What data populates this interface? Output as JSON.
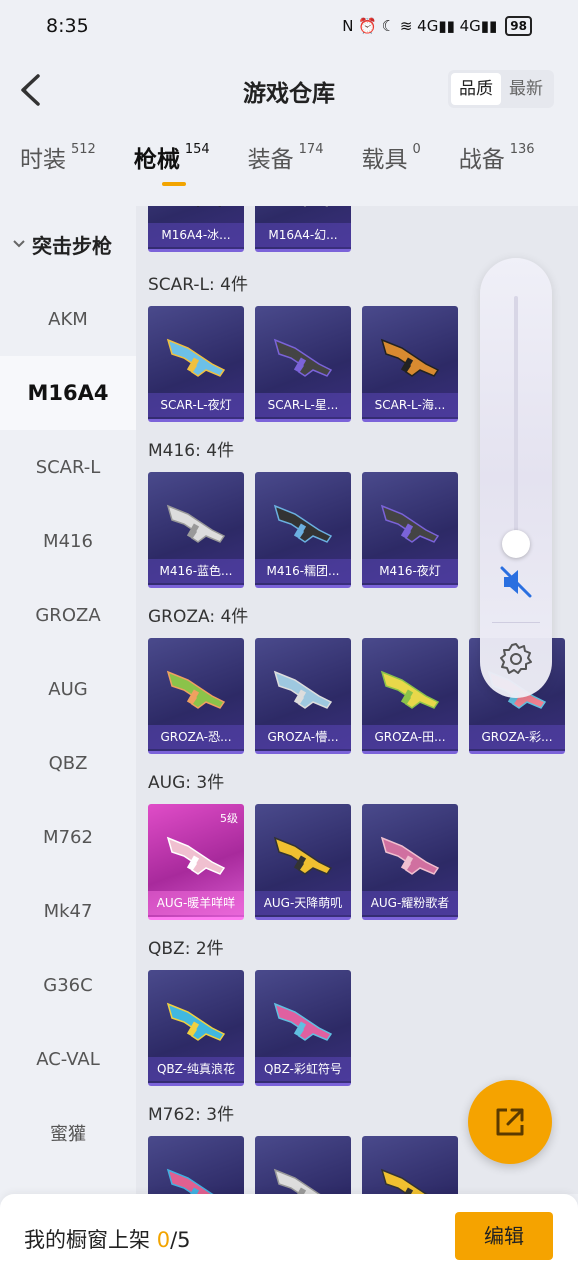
{
  "status": {
    "time": "8:35",
    "icons": "N ⏰ ☾ ≋ 4G▮▮ 4G▮▮",
    "battery": "98"
  },
  "header": {
    "title": "游戏仓库",
    "sort_options": [
      "品质",
      "最新"
    ]
  },
  "tabs": [
    {
      "label": "时装",
      "count": "512"
    },
    {
      "label": "枪械",
      "count": "154"
    },
    {
      "label": "装备",
      "count": "174"
    },
    {
      "label": "载具",
      "count": "0"
    },
    {
      "label": "战备",
      "count": "136"
    }
  ],
  "sidebar": {
    "group": "突击步枪",
    "items": [
      "AKM",
      "M16A4",
      "SCAR-L",
      "M416",
      "GROZA",
      "AUG",
      "QBZ",
      "M762",
      "Mk47",
      "G36C",
      "AC-VAL",
      "蜜獾"
    ]
  },
  "groups": [
    {
      "title": "",
      "items": [
        "M16A4-冰...",
        "M16A4-幻..."
      ]
    },
    {
      "title": "SCAR-L: 4件",
      "items": [
        "SCAR-L-夜灯",
        "SCAR-L-星...",
        "SCAR-L-海...",
        ""
      ]
    },
    {
      "title": "M416: 4件",
      "items": [
        "M416-蓝色...",
        "M416-糯团...",
        "M416-夜灯",
        ""
      ]
    },
    {
      "title": "GROZA: 4件",
      "items": [
        "GROZA-恐...",
        "GROZA-懵...",
        "GROZA-田...",
        "GROZA-彩..."
      ]
    },
    {
      "title": "AUG: 3件",
      "items": [
        "AUG-暖羊咩咩",
        "AUG-天降萌叽",
        "AUG-耀粉歌者"
      ],
      "first_level": "5级"
    },
    {
      "title": "QBZ: 2件",
      "items": [
        "QBZ-纯真浪花",
        "QBZ-彩虹符号"
      ]
    },
    {
      "title": "M762: 3件",
      "items": [
        "",
        "",
        ""
      ]
    }
  ],
  "bottom": {
    "prefix": "我的橱窗上架 ",
    "current": "0",
    "total": "/5",
    "edit_label": "编辑"
  },
  "colors": {
    "accent": "#f5a300",
    "card": "#2d2a66",
    "card_pink": "#c83cb8"
  }
}
